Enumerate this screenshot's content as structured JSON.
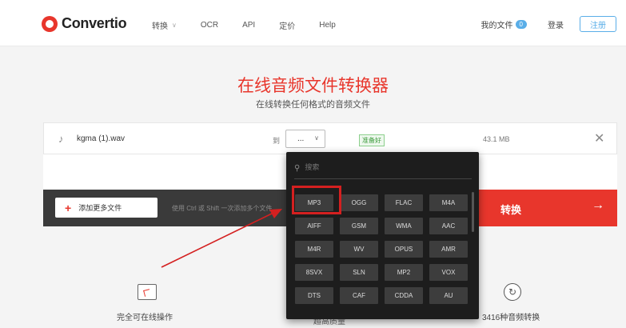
{
  "header": {
    "logo_text": "Convertio",
    "nav": [
      {
        "label": "转换",
        "has_dropdown": true
      },
      {
        "label": "OCR"
      },
      {
        "label": "API"
      },
      {
        "label": "定价"
      },
      {
        "label": "Help"
      }
    ],
    "my_files_label": "我的文件",
    "my_files_count": "0",
    "login_label": "登录",
    "signup_label": "注册"
  },
  "hero": {
    "title": "在线音频文件转换器",
    "subtitle": "在线转换任何格式的音频文件"
  },
  "file": {
    "name": "kgma (1).wav",
    "to_label": "到",
    "selected_format": "...",
    "status": "准备好",
    "size": "43.1 MB"
  },
  "actions": {
    "add_more_label": "添加更多文件",
    "hint": "使用 Ctrl 或 Shift 一次添加多个文件",
    "convert_label": "转换"
  },
  "dropdown": {
    "search_placeholder": "搜索",
    "formats": [
      "MP3",
      "OGG",
      "FLAC",
      "M4A",
      "AIFF",
      "GSM",
      "WMA",
      "AAC",
      "M4R",
      "WV",
      "OPUS",
      "AMR",
      "8SVX",
      "SLN",
      "MP2",
      "VOX",
      "DTS",
      "CAF",
      "CDDA",
      "AU"
    ],
    "highlighted": "MP3"
  },
  "features": [
    {
      "label": "完全可在线操作",
      "icon": "cursor-window-icon"
    },
    {
      "label": "超高质量",
      "icon": "quality-icon"
    },
    {
      "label": "3416种音频转换",
      "icon": "refresh-icon"
    }
  ],
  "colors": {
    "brand_red": "#e8362c",
    "accent_blue": "#5aaee8",
    "dark_bar": "#3a3a3a",
    "dropdown_bg": "#1d1d1d",
    "highlight_red": "#d42020"
  }
}
